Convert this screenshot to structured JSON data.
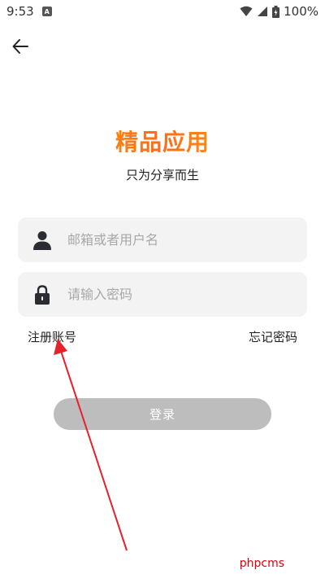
{
  "status_bar": {
    "time": "9:53",
    "notification_letter": "A",
    "battery": "100%"
  },
  "header": {
    "back_icon": "arrow-left-icon"
  },
  "brand": {
    "title": "精品应用",
    "slogan": "只为分享而生",
    "title_gradient": [
      "#f7b500",
      "#ff6a1a",
      "#ffd000"
    ]
  },
  "form": {
    "username": {
      "placeholder": "邮箱或者用户名",
      "value": "",
      "icon": "user-icon"
    },
    "password": {
      "placeholder": "请输入密码",
      "value": "",
      "icon": "lock-icon"
    },
    "register_label": "注册账号",
    "forgot_label": "忘记密码",
    "login_label": "登录",
    "login_color": "#bdbdbd"
  },
  "annotation": {
    "arrow_color": "#e8202a"
  },
  "watermark": {
    "text": "phpcms"
  }
}
